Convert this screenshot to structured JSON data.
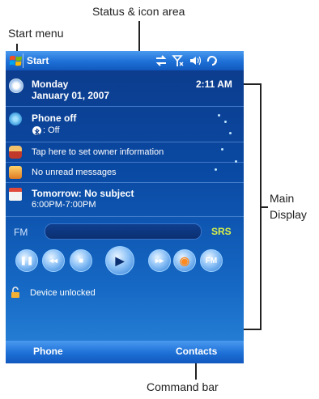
{
  "callouts": {
    "status_area": "Status & icon area",
    "start_menu": "Start menu",
    "main_display_line1": "Main",
    "main_display_line2": "Display",
    "command_bar": "Command bar"
  },
  "topbar": {
    "start_label": "Start"
  },
  "today": {
    "date_day": "Monday",
    "date_full": "January 01, 2007",
    "time": "2:11 AM",
    "phone_title": "Phone off",
    "bluetooth_status": ": Off",
    "owner_info": "Tap here to set owner information",
    "messages": "No unread messages",
    "calendar_title": "Tomorrow: No subject",
    "calendar_time": "6:00PM-7:00PM"
  },
  "radio": {
    "fm_label": "FM",
    "srs_label": "SRS",
    "fm_button_label": "FM"
  },
  "lock": {
    "label": "Device unlocked"
  },
  "command_bar": {
    "left_softkey": "Phone",
    "right_softkey": "Contacts"
  }
}
